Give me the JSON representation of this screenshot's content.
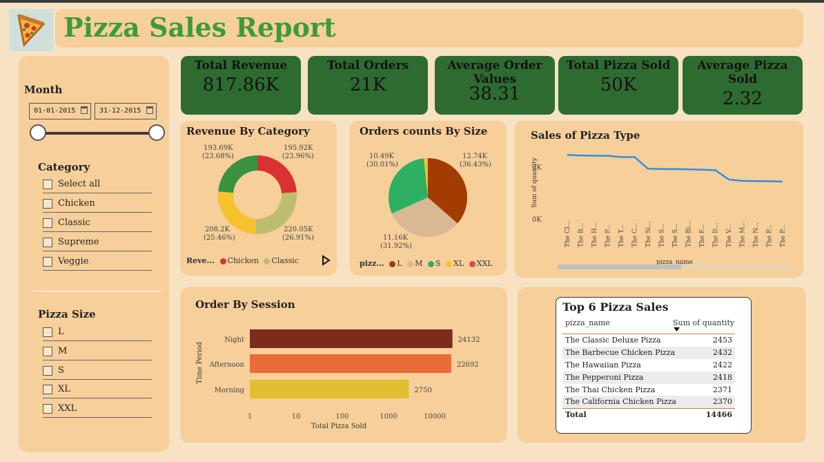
{
  "header": {
    "title": "Pizza Sales Report",
    "logo_icon": "pizza-slice-icon"
  },
  "filters": {
    "month_label": "Month",
    "date_from": "01-01-2015",
    "date_to": "31-12-2015",
    "category_label": "Category",
    "category_options": [
      "Select all",
      "Chicken",
      "Classic",
      "Supreme",
      "Veggie"
    ],
    "size_label": "Pizza Size",
    "size_options": [
      "L",
      "M",
      "S",
      "XL",
      "XXL"
    ]
  },
  "kpis": [
    {
      "label": "Total Revenue",
      "value": "817.86K"
    },
    {
      "label": "Total Orders",
      "value": "21K"
    },
    {
      "label": "Average Order Values",
      "value": "38.31"
    },
    {
      "label": "Total Pizza Sold",
      "value": "50K"
    },
    {
      "label": "Average Pizza Sold",
      "value": "2.32"
    }
  ],
  "colors": {
    "kpi_bg": "#2e6b30",
    "title": "#3c9b3c",
    "card_bg": "#f7cf9a",
    "page_bg": "#f8e2c4",
    "line": "#2f8ee6"
  },
  "chart_data": [
    {
      "type": "pie",
      "title": "Revenue By Category",
      "legend_title": "Reve...",
      "legend_visible": [
        "Chicken",
        "Classic"
      ],
      "slices": [
        {
          "name": "Chicken",
          "label": "195.92K",
          "pct": "(23.96%)",
          "value": 195.92,
          "color": "#d93232"
        },
        {
          "name": "Classic",
          "label": "220.05K",
          "pct": "(26.91%)",
          "value": 220.05,
          "color": "#bdbd72"
        },
        {
          "name": "Supreme",
          "label": "208.2K",
          "pct": "(25.46%)",
          "value": 208.2,
          "color": "#f6c22e"
        },
        {
          "name": "Veggie",
          "label": "193.69K",
          "pct": "(23.68%)",
          "value": 193.69,
          "color": "#3a9140"
        }
      ]
    },
    {
      "type": "pie",
      "title": "Orders counts By Size",
      "legend_title": "pizz...",
      "slices": [
        {
          "name": "L",
          "label": "12.74K",
          "pct": "(36.43%)",
          "value": 12.74,
          "color": "#a23c00"
        },
        {
          "name": "M",
          "label": "11.16K",
          "pct": "(31.92%)",
          "value": 11.16,
          "color": "#d8b994"
        },
        {
          "name": "S",
          "label": "10.49K",
          "pct": "(30.01%)",
          "value": 10.49,
          "color": "#2eb062"
        },
        {
          "name": "XL",
          "label": "",
          "pct": "",
          "value": 0.55,
          "color": "#f6c22e"
        },
        {
          "name": "XXL",
          "label": "",
          "pct": "",
          "value": 0.03,
          "color": "#e04848"
        }
      ]
    },
    {
      "type": "line",
      "title": "Sales of Pizza Type",
      "xlabel": "pizza_name",
      "ylabel": "Sum of quantity",
      "ylim": [
        0,
        2700
      ],
      "yticks": [
        {
          "v": 0,
          "label": "0K"
        },
        {
          "v": 2000,
          "label": "2K"
        }
      ],
      "categories": [
        "The Cl...",
        "The B...",
        "The H...",
        "The P...",
        "The T...",
        "The C...",
        "The Si...",
        "The S...",
        "The S...",
        "The Bi...",
        "The F...",
        "The It...",
        "The V...",
        "The M...",
        "The N...",
        "The P...",
        "The P..."
      ],
      "values": [
        2453,
        2432,
        2422,
        2418,
        2371,
        2370,
        1924,
        1914,
        1908,
        1902,
        1887,
        1870,
        1510,
        1460,
        1450,
        1445,
        1430
      ]
    },
    {
      "type": "bar",
      "title": "Order By Session",
      "orientation": "horizontal",
      "xlabel": "Total Pizza Sold",
      "ylabel": "Time Period",
      "scale": "log",
      "xticks": [
        1,
        10,
        100,
        1000,
        10000
      ],
      "categories": [
        "Night",
        "Afternoon",
        "Morning"
      ],
      "values": [
        24132,
        22692,
        2750
      ],
      "colors": [
        "#7a2e1a",
        "#e96b37",
        "#e0c030"
      ]
    }
  ],
  "top_table": {
    "title": "Top 6 Pizza Sales",
    "col_name": "pizza_name",
    "col_qty": "Sum of quantity",
    "rows": [
      {
        "name": "The Classic Deluxe Pizza",
        "qty": "2453"
      },
      {
        "name": "The Barbecue Chicken Pizza",
        "qty": "2432"
      },
      {
        "name": "The Hawaiian Pizza",
        "qty": "2422"
      },
      {
        "name": "The Pepperoni Pizza",
        "qty": "2418"
      },
      {
        "name": "The Thai Chicken Pizza",
        "qty": "2371"
      },
      {
        "name": "The California Chicken Pizza",
        "qty": "2370"
      }
    ],
    "total_label": "Total",
    "total_value": "14466"
  }
}
